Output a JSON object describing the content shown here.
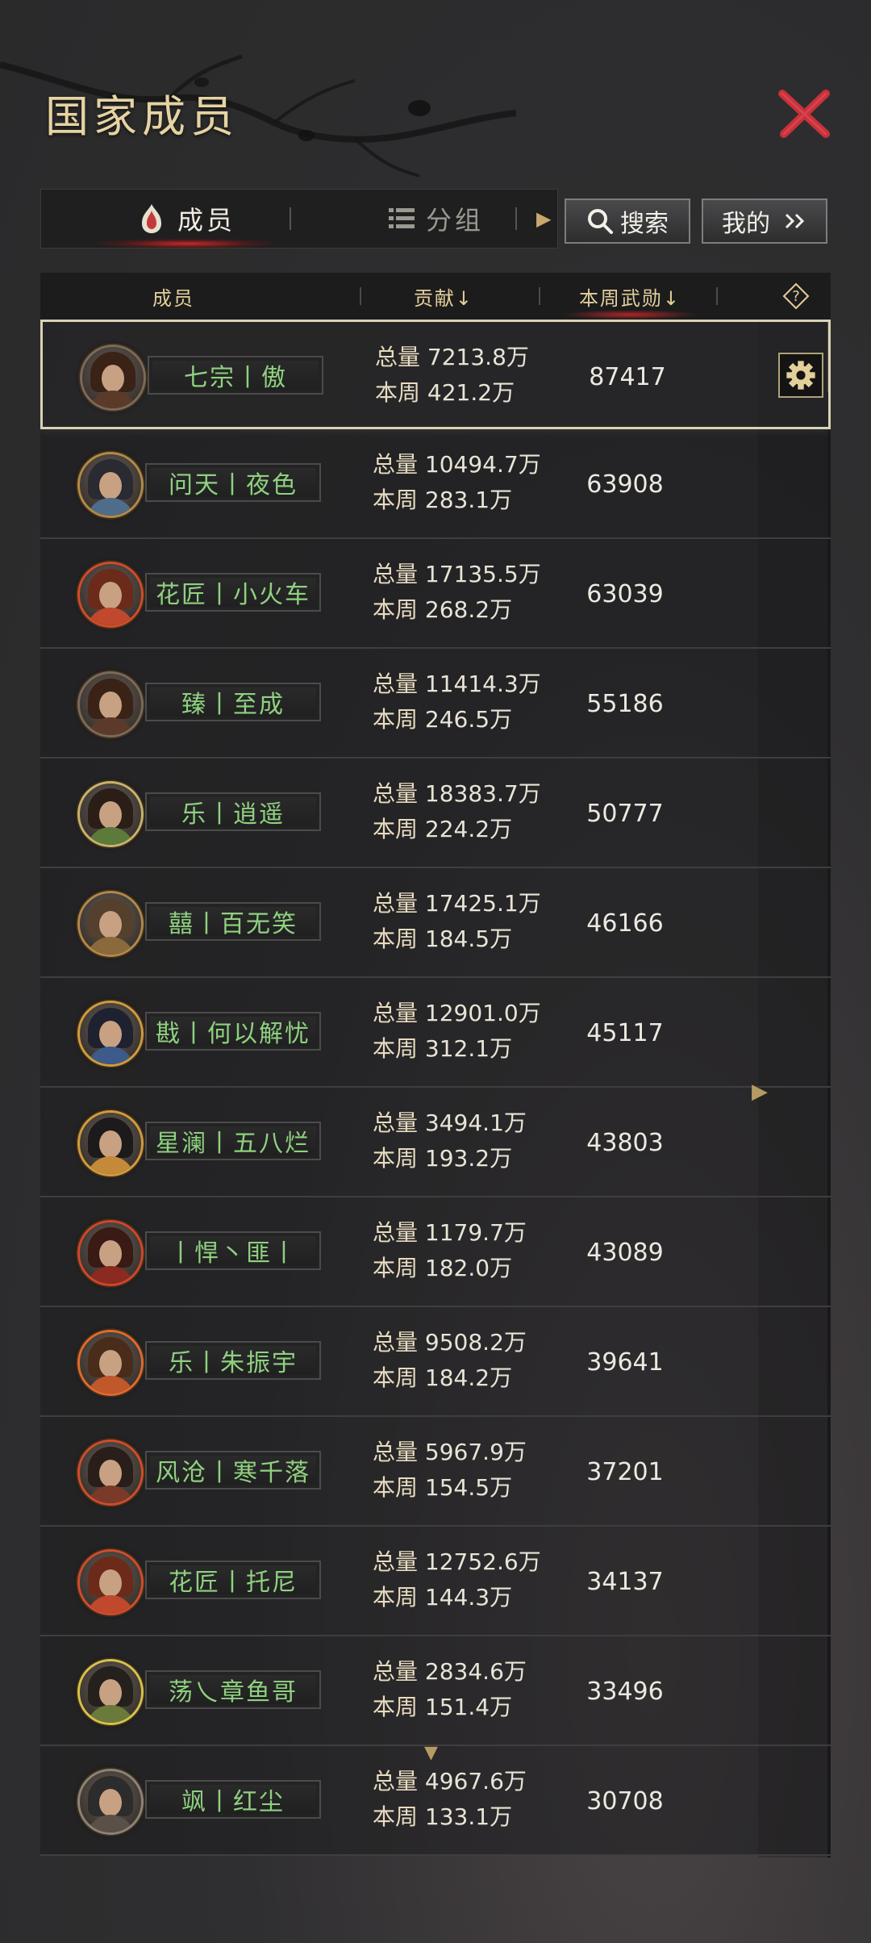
{
  "title": "国家成员",
  "tabs": {
    "members": "成员",
    "groups": "分组"
  },
  "buttons": {
    "search": "搜索",
    "mine": "我的"
  },
  "table_header": {
    "member": "成员",
    "contribution": "贡献↓",
    "weekly_merit": "本周武勋↓"
  },
  "labels": {
    "total": "总量",
    "week": "本周"
  },
  "rows": [
    {
      "name": "七宗丨傲",
      "total": "7213.8万",
      "week": "421.2万",
      "merit": "87417",
      "hair": "#3a2216",
      "body": "#5b3a2a",
      "ring": "#7a6a5a"
    },
    {
      "name": "问天丨夜色",
      "total": "10494.7万",
      "week": "283.1万",
      "merit": "63908",
      "hair": "#2a2a33",
      "body": "#4f6c8a",
      "ring": "#b08a48"
    },
    {
      "name": "花匠丨小火车",
      "total": "17135.5万",
      "week": "268.2万",
      "merit": "63039",
      "hair": "#6b2a1a",
      "body": "#c0482c",
      "ring": "#d24b2a"
    },
    {
      "name": "臻丨至成",
      "total": "11414.3万",
      "week": "246.5万",
      "merit": "55186",
      "hair": "#3a2216",
      "body": "#5b3a2a",
      "ring": "#7a6a5a"
    },
    {
      "name": "乐丨逍遥",
      "total": "18383.7万",
      "week": "224.2万",
      "merit": "50777",
      "hair": "#2b1e17",
      "body": "#5c7a3a",
      "ring": "#c7b36a"
    },
    {
      "name": "囍丨百无笑",
      "total": "17425.1万",
      "week": "184.5万",
      "merit": "46166",
      "hair": "#54402c",
      "body": "#8a6a3c",
      "ring": "#b0884a"
    },
    {
      "name": "戡丨何以解忧",
      "total": "12901.0万",
      "week": "312.1万",
      "merit": "45117",
      "hair": "#1e2230",
      "body": "#3c5a8a",
      "ring": "#d19b3c"
    },
    {
      "name": "星澜丨五八烂",
      "total": "3494.1万",
      "week": "193.2万",
      "merit": "43803",
      "hair": "#1c1a1a",
      "body": "#c48a3a",
      "ring": "#d19b3c"
    },
    {
      "name": "丨悍丶匪丨",
      "total": "1179.7万",
      "week": "182.0万",
      "merit": "43089",
      "hair": "#3a1a14",
      "body": "#8a2a20",
      "ring": "#d2452a"
    },
    {
      "name": "乐丨朱振宇",
      "total": "9508.2万",
      "week": "184.2万",
      "merit": "39641",
      "hair": "#4a2c1a",
      "body": "#c0582c",
      "ring": "#e06a2a"
    },
    {
      "name": "风沧丨寒千落",
      "total": "5967.9万",
      "week": "154.5万",
      "merit": "37201",
      "hair": "#2a1e1a",
      "body": "#7a3a2a",
      "ring": "#d24b2a"
    },
    {
      "name": "花匠丨托尼",
      "total": "12752.6万",
      "week": "144.3万",
      "merit": "34137",
      "hair": "#6b2a1a",
      "body": "#c0482c",
      "ring": "#d24b2a"
    },
    {
      "name": "荡乀章鱼哥",
      "total": "2834.6万",
      "week": "151.4万",
      "merit": "33496",
      "hair": "#24201c",
      "body": "#6a7a3a",
      "ring": "#d6c24a"
    },
    {
      "name": "飒丨红尘",
      "total": "4967.6万",
      "week": "133.1万",
      "merit": "30708",
      "hair": "#2c2c2c",
      "body": "#5a5048",
      "ring": "#8a8478"
    }
  ],
  "colors": {
    "name_green": "#8fd17f",
    "title_gold": "#e6d3a2",
    "close_red": "#c8313a",
    "selected_border": "#d9d2b5"
  },
  "icons": [
    "close-icon",
    "members-tab-icon",
    "groups-list-icon",
    "search-icon",
    "double-chevron-right-icon",
    "help-icon",
    "gear-icon"
  ]
}
